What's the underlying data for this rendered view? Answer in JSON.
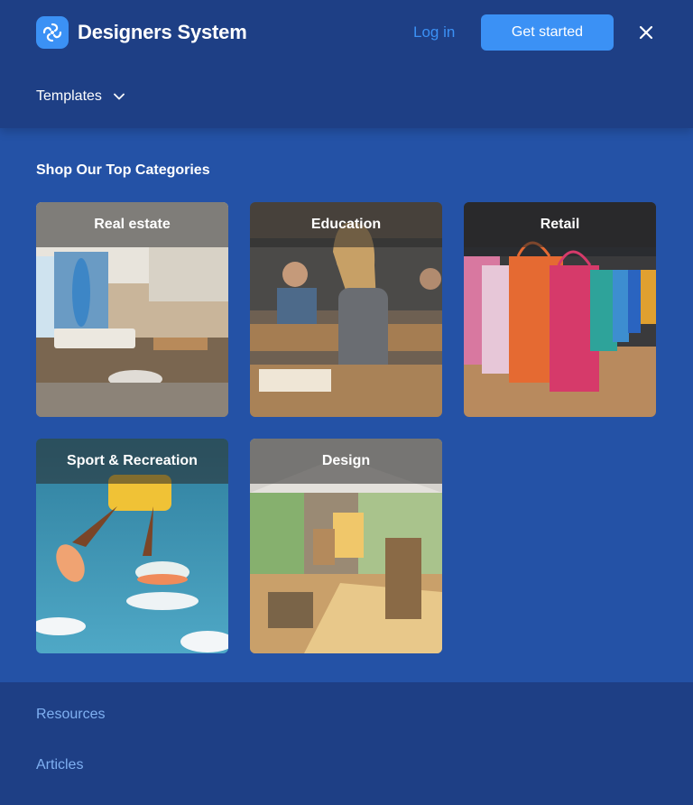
{
  "brand": {
    "name": "Designers System",
    "logo_icon": "swirl-logo-icon",
    "accent": "#3b91f5"
  },
  "header": {
    "login_label": "Log in",
    "cta_label": "Get started",
    "close_icon": "close-icon"
  },
  "nav": {
    "templates_label": "Templates",
    "templates_icon": "chevron-down-icon"
  },
  "categories": {
    "title": "Shop Our Top Categories",
    "items": [
      {
        "label": "Real estate"
      },
      {
        "label": "Education"
      },
      {
        "label": "Retail"
      },
      {
        "label": "Sport & Recreation"
      },
      {
        "label": "Design"
      }
    ]
  },
  "footer": {
    "links": [
      {
        "label": "Resources"
      },
      {
        "label": "Articles"
      }
    ]
  },
  "colors": {
    "header_bg": "#1e3f85",
    "main_bg": "#2452a6",
    "footer_link": "#7fb0f2"
  }
}
